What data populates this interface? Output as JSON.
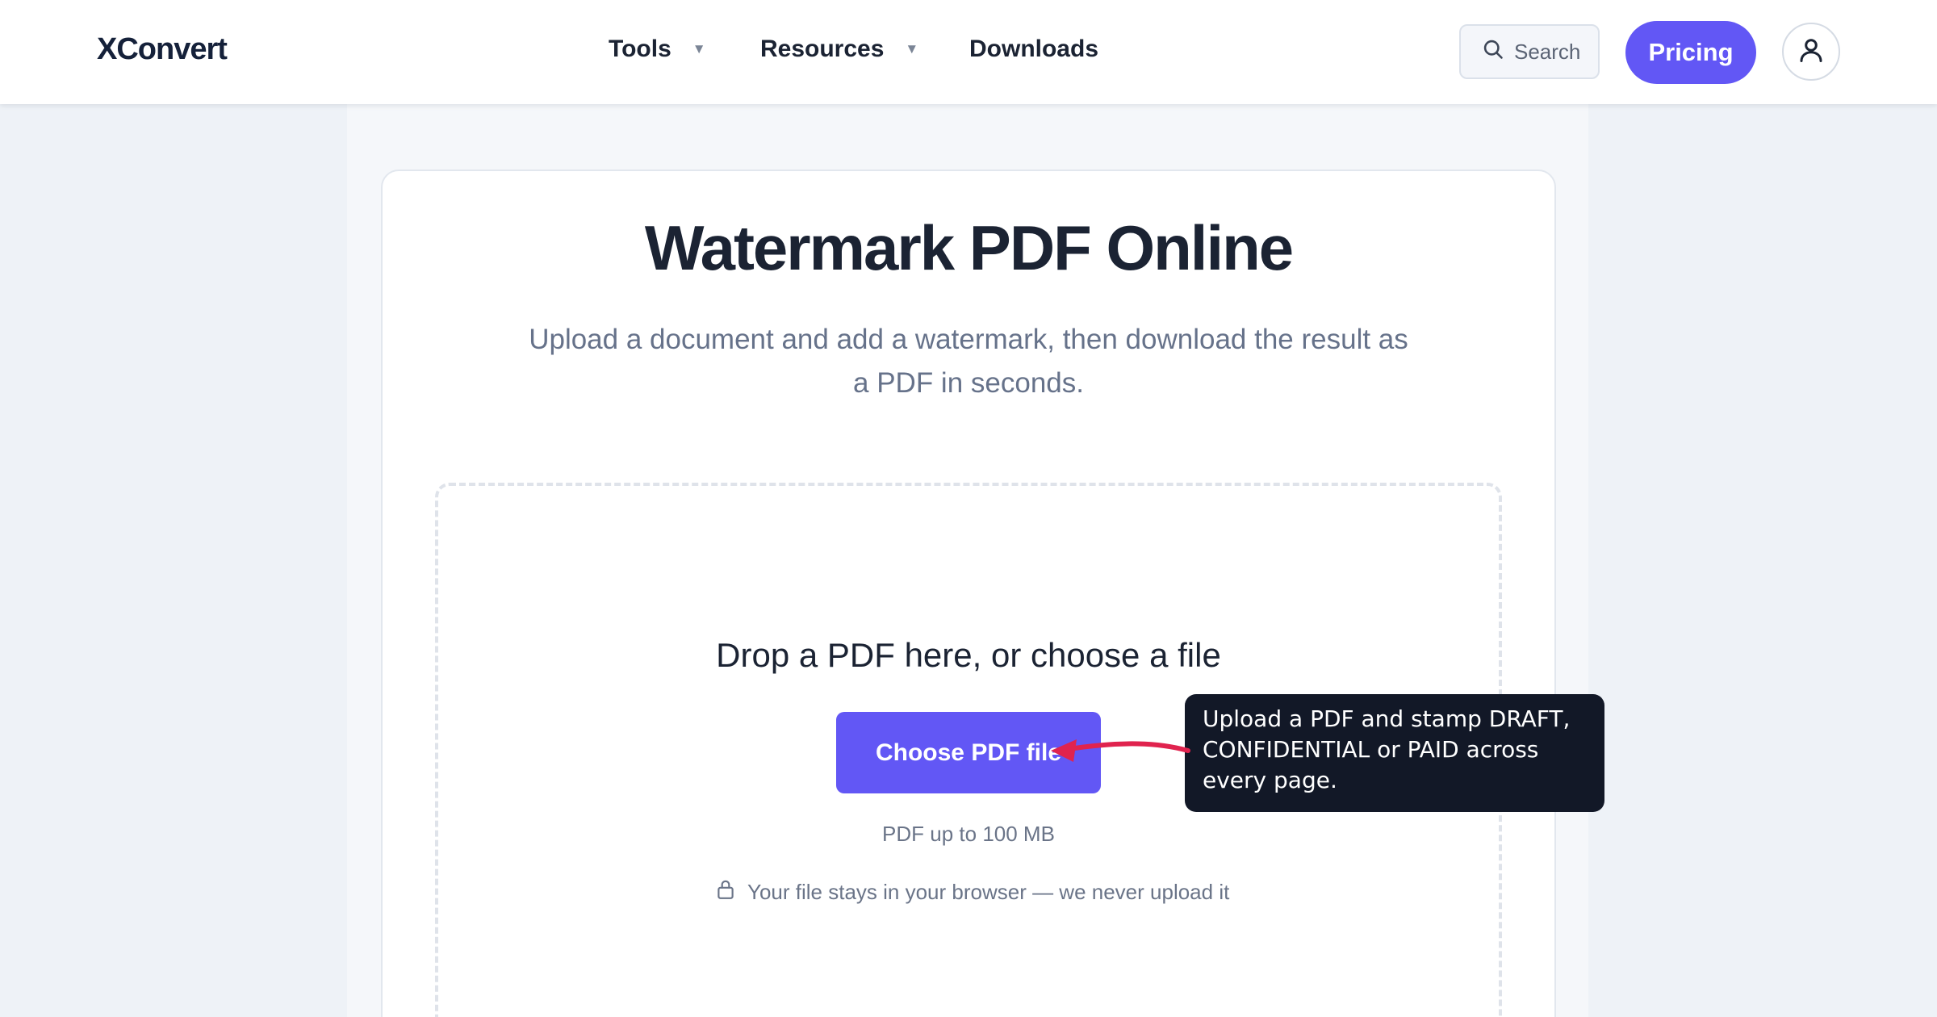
{
  "header": {
    "logo": "XConvert",
    "nav": [
      {
        "label": "Tools",
        "dropdown": true
      },
      {
        "label": "Resources",
        "dropdown": true
      },
      {
        "label": "Downloads",
        "dropdown": false
      }
    ],
    "search_label": "Search",
    "pricing_label": "Pricing"
  },
  "main": {
    "title": "Watermark PDF Online",
    "subtitle": "Upload a document and add a watermark, then download the result as a PDF in seconds.",
    "dropzone": {
      "heading": "Drop a PDF here, or choose a file",
      "button_label": "Choose PDF file",
      "limit": "PDF up to 100 MB",
      "privacy": "Your file stays in your browser — we never upload it"
    }
  },
  "tooltip": {
    "text": "Upload a PDF and stamp DRAFT, CONFIDENTIAL or PAID across every page."
  },
  "colors": {
    "accent": "#6257f5",
    "arrow": "#e0234e",
    "tooltip_bg": "#121827"
  },
  "icons": {
    "search": "search-icon",
    "avatar": "user-icon",
    "caret": "chevron-down-icon",
    "lock": "lock-icon"
  }
}
